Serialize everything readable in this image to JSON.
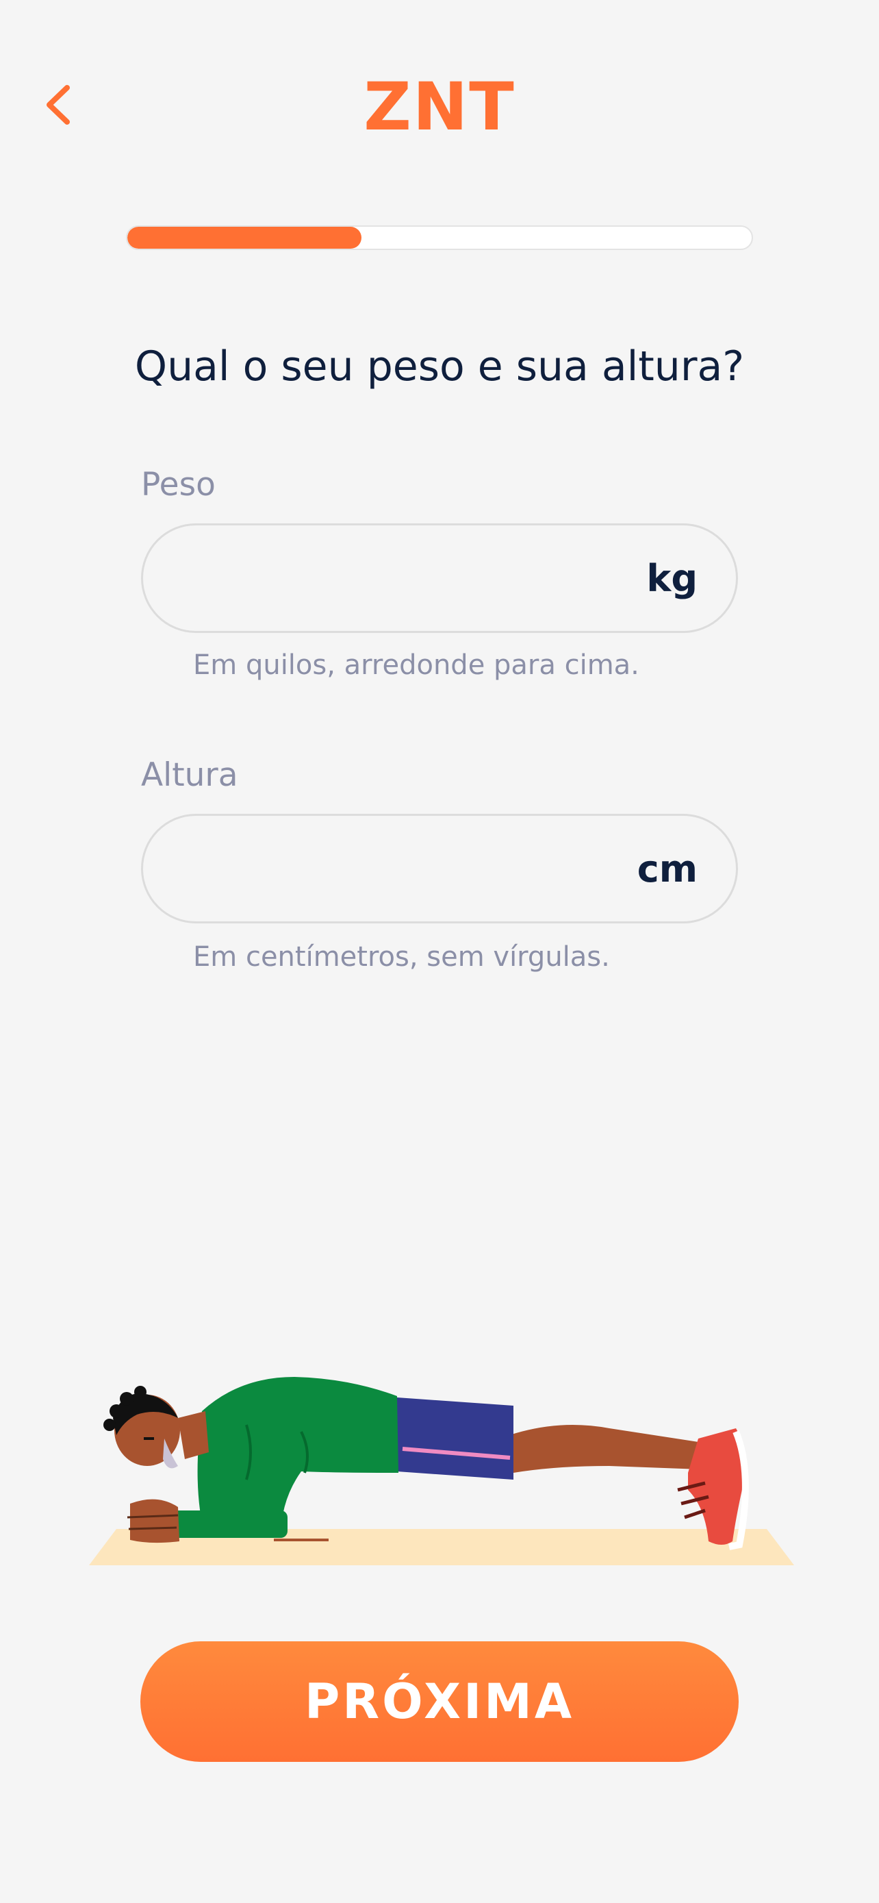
{
  "colors": {
    "accent": "#ff7033",
    "accent_light": "#ff8a3d",
    "text_dark": "#0f1f3d",
    "text_muted": "#8b8fa7",
    "background": "#f5f5f5"
  },
  "header": {
    "back_icon": "chevron-left-icon",
    "logo_text": "ZNT"
  },
  "progress": {
    "fraction": 0.375
  },
  "question": "Qual o seu peso e sua altura?",
  "fields": {
    "weight": {
      "label": "Peso",
      "value": "",
      "unit": "kg",
      "hint": "Em quilos, arredonde para cima."
    },
    "height": {
      "label": "Altura",
      "value": "",
      "unit": "cm",
      "hint": "Em centímetros, sem vírgulas."
    }
  },
  "illustration": "person-planking-illustration",
  "next_button": {
    "label": "PRÓXIMA"
  }
}
